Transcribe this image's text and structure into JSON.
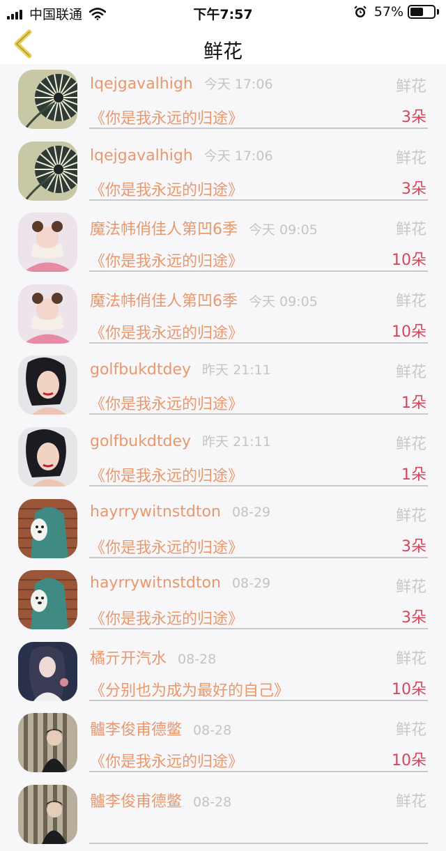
{
  "status": {
    "carrier": "中国联通",
    "time": "下午7:57",
    "battery": "57%",
    "battery_level": 0.57
  },
  "nav": {
    "title": "鲜花"
  },
  "items": [
    {
      "user": "lqejgavalhigh",
      "time": "今天 17:06",
      "tag": "鲜花",
      "message": "《你是我永远的归途》",
      "count": "3朵",
      "avatar": "dandelion-avatar"
    },
    {
      "user": "lqejgavalhigh",
      "time": "今天 17:06",
      "tag": "鲜花",
      "message": "《你是我永远的归途》",
      "count": "3朵",
      "avatar": "dandelion-avatar"
    },
    {
      "user": "魔法帏俏佳人第凹6季",
      "time": "今天 09:05",
      "tag": "鲜花",
      "message": "《你是我永远的归途》",
      "count": "10朵",
      "avatar": "pink-girl-avatar"
    },
    {
      "user": "魔法帏俏佳人第凹6季",
      "time": "今天 09:05",
      "tag": "鲜花",
      "message": "《你是我永远的归途》",
      "count": "10朵",
      "avatar": "pink-girl-avatar"
    },
    {
      "user": "golfbukdtdey",
      "time": "昨天 21:11",
      "tag": "鲜花",
      "message": "《你是我永远的归途》",
      "count": "1朵",
      "avatar": "woman-portrait-avatar"
    },
    {
      "user": "golfbukdtdey",
      "time": "昨天 21:11",
      "tag": "鲜花",
      "message": "《你是我永远的归途》",
      "count": "1朵",
      "avatar": "woman-portrait-avatar"
    },
    {
      "user": "hayrrywitnstdton",
      "time": "08-29",
      "tag": "鲜花",
      "message": "《你是我永远的归途》",
      "count": "3朵",
      "avatar": "bear-hoodie-avatar"
    },
    {
      "user": "hayrrywitnstdton",
      "time": "08-29",
      "tag": "鲜花",
      "message": "《你是我永远的归途》",
      "count": "3朵",
      "avatar": "bear-hoodie-avatar"
    },
    {
      "user": "橘亓开汽水",
      "time": "08-28",
      "tag": "鲜花",
      "message": "《分别也为成为最好的自己》",
      "count": "10朵",
      "avatar": "anime-girl-avatar"
    },
    {
      "user": "髗李俊甫德鳖",
      "time": "08-28",
      "tag": "鲜花",
      "message": "《你是我永远的归途》",
      "count": "10朵",
      "avatar": "man-portrait-avatar"
    },
    {
      "user": "髗李俊甫德鳖",
      "time": "08-28",
      "tag": "鲜花",
      "message": "",
      "count": "",
      "avatar": "man-portrait-avatar"
    }
  ]
}
